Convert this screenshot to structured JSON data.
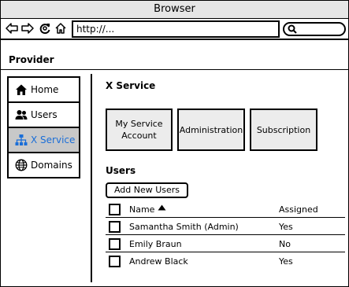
{
  "window": {
    "title": "Browser"
  },
  "navbar": {
    "url": "http://..."
  },
  "provider": "Provider",
  "sidebar": {
    "items": [
      {
        "label": "Home"
      },
      {
        "label": "Users"
      },
      {
        "label": "X Service"
      },
      {
        "label": "Domains"
      }
    ],
    "active_index": 2
  },
  "main": {
    "title": "X Service",
    "tiles": [
      {
        "label": "My Service Account"
      },
      {
        "label": "Administration"
      },
      {
        "label": "Subscription"
      }
    ],
    "users": {
      "title": "Users",
      "add_button": "Add New Users",
      "columns": {
        "name": "Name",
        "assigned": "Assigned"
      },
      "rows": [
        {
          "name": "Samantha Smith (Admin)",
          "assigned": "Yes"
        },
        {
          "name": "Emily Braun",
          "assigned": "No"
        },
        {
          "name": "Andrew Black",
          "assigned": "Yes"
        }
      ]
    }
  },
  "colors": {
    "active_text": "#1a6ed8",
    "active_bg": "#c8c8c8",
    "tile_bg": "#ececec",
    "titlebar_bg": "#e6e6e6"
  }
}
